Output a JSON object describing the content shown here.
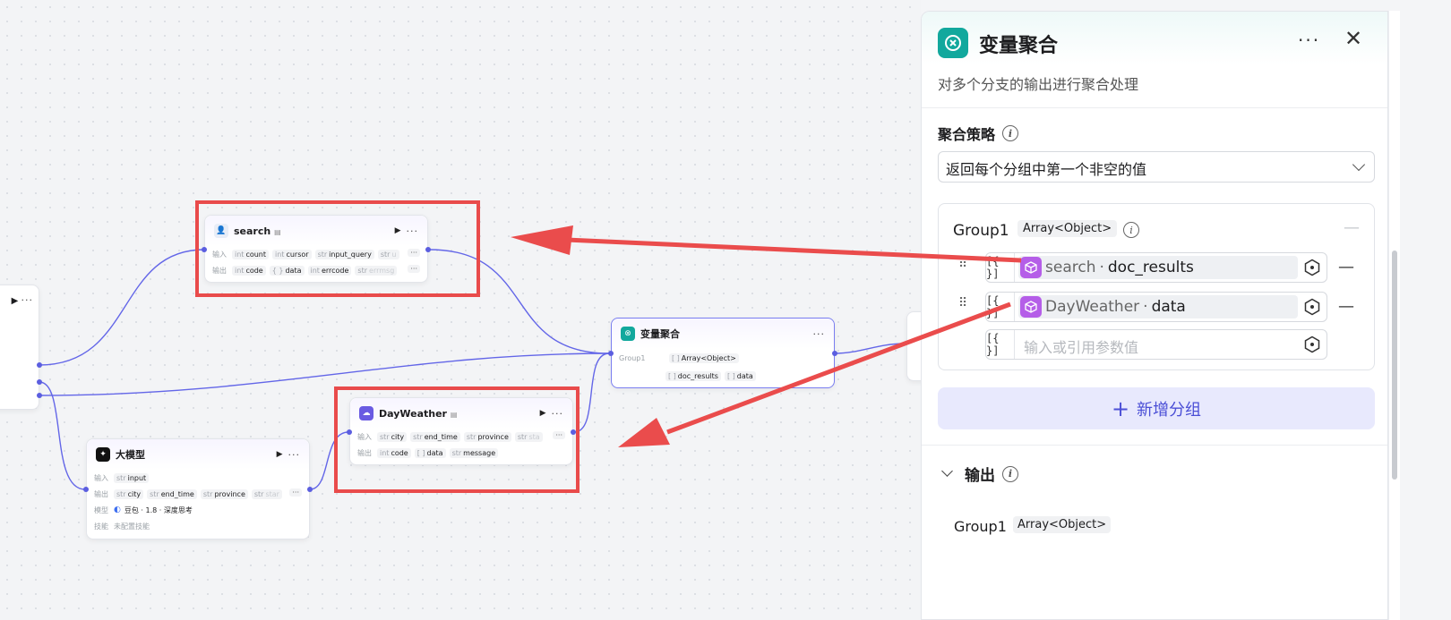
{
  "canvas": {
    "nodes": {
      "search": {
        "title": "search",
        "input_label": "输入",
        "output_label": "输出",
        "inputs": [
          {
            "type": "int",
            "name": "count"
          },
          {
            "type": "int",
            "name": "cursor"
          },
          {
            "type": "str",
            "name": "input_query"
          },
          {
            "type": "str",
            "name": "u"
          }
        ],
        "outputs": [
          {
            "type": "int",
            "name": "code"
          },
          {
            "type": "{ }",
            "name": "data"
          },
          {
            "type": "int",
            "name": "errcode"
          },
          {
            "type": "str",
            "name": "errmsg"
          }
        ],
        "more": "···"
      },
      "aggregate": {
        "title": "变量聚合",
        "group_label": "Group1",
        "group_type": "Array<Object>",
        "items": [
          "doc_results",
          "data"
        ],
        "list_type": "[ ]"
      },
      "dayweather": {
        "title": "DayWeather",
        "input_label": "输入",
        "output_label": "输出",
        "inputs": [
          {
            "type": "str",
            "name": "city"
          },
          {
            "type": "str",
            "name": "end_time"
          },
          {
            "type": "str",
            "name": "province"
          },
          {
            "type": "str",
            "name": "sta"
          }
        ],
        "outputs": [
          {
            "type": "int",
            "name": "code"
          },
          {
            "type": "[ ]",
            "name": "data"
          },
          {
            "type": "str",
            "name": "message"
          }
        ],
        "more": "···"
      },
      "llm": {
        "title": "大模型",
        "input_label": "输入",
        "output_label": "输出",
        "model_label": "模型",
        "skill_label": "技能",
        "inputs": [
          {
            "type": "str",
            "name": "input"
          }
        ],
        "outputs": [
          {
            "type": "str",
            "name": "city"
          },
          {
            "type": "str",
            "name": "end_time"
          },
          {
            "type": "str",
            "name": "province"
          },
          {
            "type": "str",
            "name": "star"
          }
        ],
        "model_value": "豆包 · 1.8 · 深度思考",
        "skill_value": "未配置技能",
        "more": "···"
      }
    },
    "colors": {
      "edge": "#6366e8",
      "highlight": "#e94b4b"
    }
  },
  "panel": {
    "title": "变量聚合",
    "description": "对多个分支的输出进行聚合处理",
    "more_icon": "more-icon",
    "close_icon": "close-icon",
    "strategy": {
      "label": "聚合策略",
      "value": "返回每个分组中第一个非空的值"
    },
    "group": {
      "name": "Group1",
      "type": "Array<Object>",
      "rows": [
        {
          "type_icon": "[{ }]",
          "node": "search",
          "sep": " · ",
          "field": "doc_results"
        },
        {
          "type_icon": "[{ }]",
          "node": "DayWeather",
          "sep": " · ",
          "field": "data"
        }
      ],
      "empty_row": {
        "type_icon": "[{ }]",
        "placeholder": "输入或引用参数值"
      }
    },
    "add_group_label": "新增分组",
    "output": {
      "label": "输出",
      "group_name": "Group1",
      "group_type": "Array<Object>"
    },
    "accent": "#12a89d"
  }
}
